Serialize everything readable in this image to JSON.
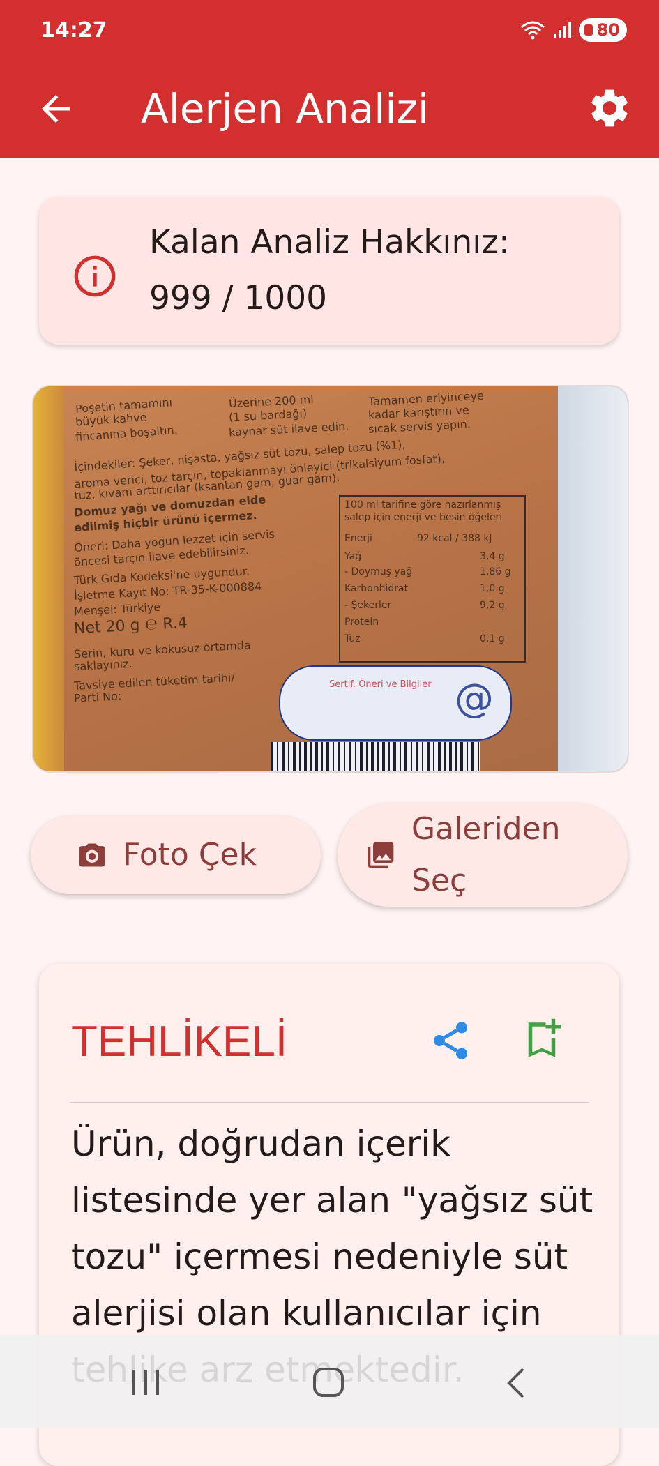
{
  "status": {
    "time": "14:27",
    "battery": "80"
  },
  "appbar": {
    "title": "Alerjen Analizi"
  },
  "quota": {
    "label": "Kalan Analiz Hakkınız:",
    "value": "999 / 1000"
  },
  "photo": {
    "lines": [
      "Poşetin tamamını",
      "büyük kahve",
      "fincanına boşaltın.",
      "Üzerine 200 ml",
      "(1 su bardağı)",
      "kaynar süt ilave edin.",
      "Tamamen eriyinceye",
      "kadar karıştırın ve",
      "sıcak servis yapın.",
      "İçindekiler: Şeker, nişasta, yağsız süt tozu, salep tozu (%1),",
      "aroma verici, toz tarçın, topaklanmayı önleyici (trikalsiyum fosfat),",
      "tuz, kıvam arttırıcılar (ksantan gam, guar gam).",
      "Domuz yağı ve domuzdan elde",
      "edilmiş hiçbir ürünü içermez.",
      "Öneri: Daha yoğun lezzet için servis",
      "öncesi tarçın ilave edebilirsiniz.",
      "Türk Gıda Kodeksi'ne uygundur.",
      "İşletme Kayıt No: TR-35-K-000884",
      "Menşei: Türkiye",
      "Net 20 g ℮ R.4",
      "Serin, kuru ve kokusuz ortamda",
      "saklayınız.",
      "Tavsiye edilen tüketim tarihi/",
      "Parti No:",
      "100 ml tarifine göre hazırlanmış",
      "salep için enerji ve besin öğeleri",
      "Enerji",
      "92 kcal / 388 kJ",
      "Yağ",
      "3,4 g",
      "- Doymuş yağ",
      "1,86 g",
      "Karbonhidrat",
      "1,0 g",
      "- Şekerler",
      "9,2 g",
      "Protein",
      "Tuz",
      "0,1 g",
      "Sertif. Öneri ve Bilgiler",
      "@"
    ]
  },
  "buttons": {
    "camera": "Foto Çek",
    "gallery_line1": "Galeriden",
    "gallery_line2": "Seç"
  },
  "result": {
    "verdict": "TEHLİKELİ",
    "verdict_color": "#d32f2f",
    "description": "Ürün, doğrudan içerik listesinde yer alan \"yağsız süt tozu\" içermesi nedeniyle süt alerjisi olan kullanıcılar için tehlike arz etmektedir."
  },
  "colors": {
    "primary": "#d32f2f",
    "share": "#2f8ae6",
    "bookmark": "#43a047"
  }
}
